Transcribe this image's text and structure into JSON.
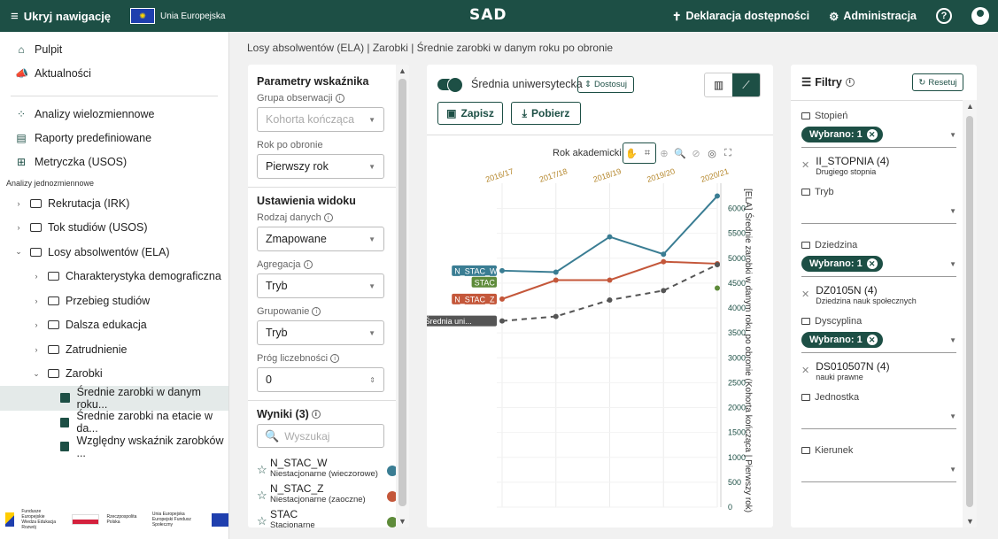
{
  "topbar": {
    "hide_nav": "Ukryj nawigację",
    "eu_label": "Unia Europejska",
    "logo": "SAD",
    "accessibility": "Deklaracja dostępności",
    "admin": "Administracja",
    "help": "?",
    "accent": "#1d4f45"
  },
  "sidebar": {
    "top_items": [
      {
        "label": "Pulpit",
        "icon": "home-icon"
      },
      {
        "label": "Aktualności",
        "icon": "megaphone-icon"
      }
    ],
    "analysis_items": [
      {
        "label": "Analizy wielozmiennowe",
        "icon": "scatter-icon"
      },
      {
        "label": "Raporty predefiniowane",
        "icon": "report-icon"
      },
      {
        "label": "Metryczka (USOS)",
        "icon": "table-icon"
      }
    ],
    "section_label": "Analizy jednozmiennowe",
    "tree": [
      {
        "label": "Rekrutacja (IRK)"
      },
      {
        "label": "Tok studiów (USOS)"
      },
      {
        "label": "Losy absolwentów (ELA)"
      },
      {
        "label": "Charakterystyka demograficzna"
      },
      {
        "label": "Przebieg studiów"
      },
      {
        "label": "Dalsza edukacja"
      },
      {
        "label": "Zatrudnienie"
      },
      {
        "label": "Zarobki"
      },
      {
        "label": "Średnie zarobki w danym roku..."
      },
      {
        "label": "Średnie zarobki na etacie w da..."
      },
      {
        "label": "Względny wskaźnik zarobków ..."
      }
    ],
    "footer": {
      "fe": "Fundusze Europejskie",
      "fe_sub": "Wiedza Edukacja Rozwój",
      "pl": "Rzeczpospolita Polska",
      "eu": "Unia Europejska",
      "eu_sub": "Europejski Fundusz Społeczny"
    }
  },
  "breadcrumb": "Losy absolwentów (ELA) | Zarobki | Średnie zarobki w danym roku po obronie",
  "params": {
    "heading": "Parametry wskaźnika",
    "group_label": "Grupa obserwacji",
    "group_value": "Kohorta kończąca",
    "year_label": "Rok po obronie",
    "year_value": "Pierwszy rok",
    "view_heading": "Ustawienia widoku",
    "data_type_label": "Rodzaj danych",
    "data_type_value": "Zmapowane",
    "aggregation_label": "Agregacja",
    "aggregation_value": "Tryb",
    "grouping_label": "Grupowanie",
    "grouping_value": "Tryb",
    "threshold_label": "Próg liczebności",
    "threshold_value": "0",
    "results_heading": "Wyniki (3)",
    "search_placeholder": "Wyszukaj",
    "results": [
      {
        "name": "N_STAC_W",
        "desc": "Niestacjonarne (wieczorowe)",
        "color": "#3a7d93"
      },
      {
        "name": "N_STAC_Z",
        "desc": "Niestacjonarne (zaoczne)",
        "color": "#c4573a"
      },
      {
        "name": "STAC",
        "desc": "Stacjonarne",
        "color": "#5e8b3a"
      }
    ]
  },
  "chart_panel": {
    "toggle_label": "Średnia uniwersytecka",
    "adjust": "Dostosuj",
    "save": "Zapisz",
    "download": "Pobierz",
    "tools_label": "Rok akademicki"
  },
  "chart_data": {
    "type": "line",
    "categories": [
      "2016/17",
      "2017/18",
      "2018/19",
      "2019/20",
      "2020/21"
    ],
    "ylabel": "[ELA] Średnie zarobki w danym roku po obronie (Kohorta kończąca | Pierwszy rok)",
    "ylim": [
      0,
      6400
    ],
    "yticks": [
      0,
      500,
      1000,
      1500,
      2000,
      2500,
      3000,
      3500,
      4000,
      4500,
      5000,
      5500,
      6000
    ],
    "series": [
      {
        "name": "N_STAC_W",
        "color": "#3a7d93",
        "values": [
          4750,
          4720,
          5430,
          5080,
          6250
        ]
      },
      {
        "name": "N_STAC_Z",
        "color": "#c4573a",
        "values": [
          4180,
          4560,
          4560,
          4930,
          4890
        ]
      },
      {
        "name": "STAC",
        "color": "#5e8b3a",
        "values": [
          null,
          null,
          null,
          null,
          4400
        ]
      },
      {
        "name": "Średnia uni...",
        "color": "#555555",
        "dashed": true,
        "values": [
          3740,
          3830,
          4160,
          4350,
          4870
        ]
      }
    ]
  },
  "filters": {
    "heading": "Filtry",
    "reset": "Resetuj",
    "chip": "Wybrano: 1",
    "groups": [
      {
        "title": "Stopień",
        "selected": true,
        "value": "II_STOPNIA (4)",
        "desc": "Drugiego stopnia"
      },
      {
        "title": "Tryb",
        "selected": false
      },
      {
        "title": "Dziedzina",
        "selected": true,
        "value": "DZ0105N (4)",
        "desc": "Dziedzina nauk społecznych"
      },
      {
        "title": "Dyscyplina",
        "selected": true,
        "value": "DS010507N (4)",
        "desc": "nauki prawne"
      },
      {
        "title": "Jednostka",
        "selected": false
      },
      {
        "title": "Kierunek",
        "selected": false
      }
    ]
  }
}
